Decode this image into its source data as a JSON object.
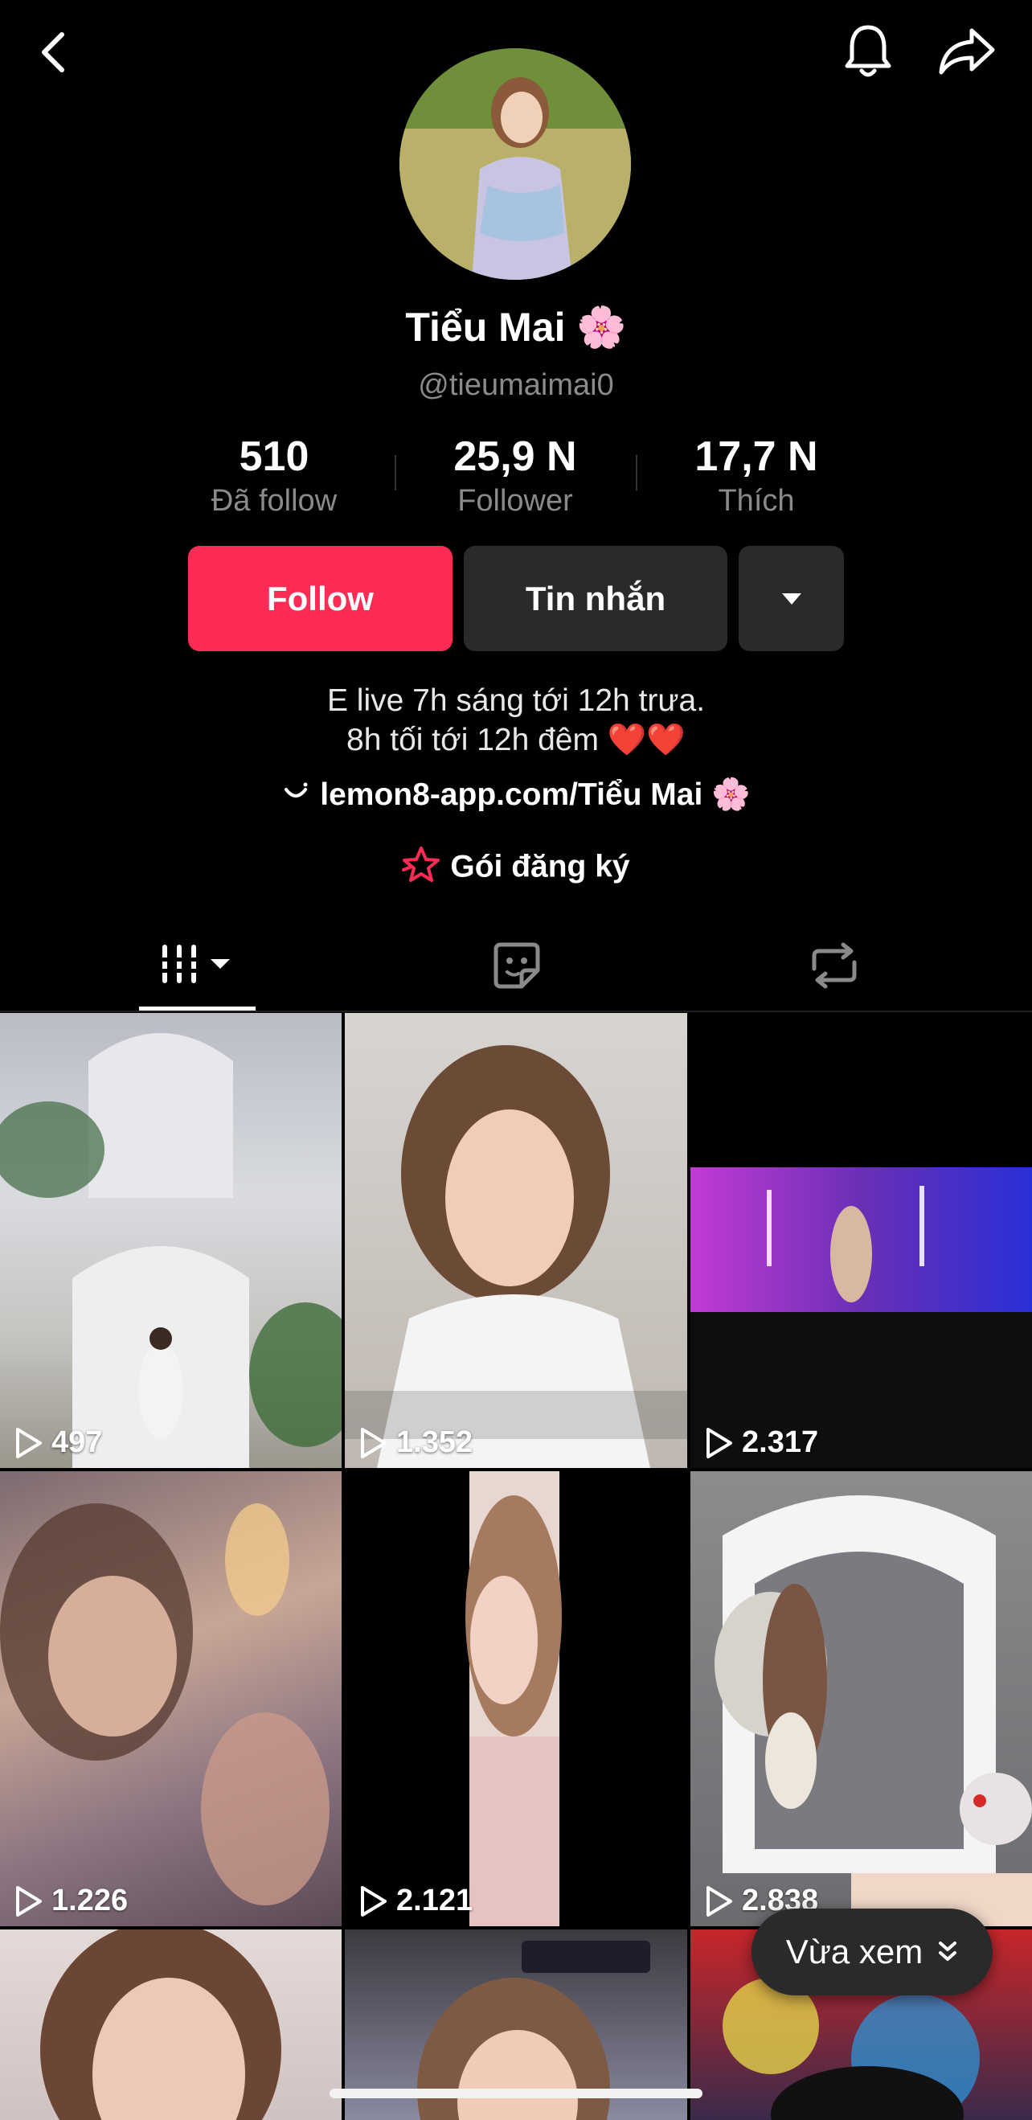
{
  "profile": {
    "display_name": "Tiểu Mai 🌸",
    "handle": "@tieumaimai0"
  },
  "stats": [
    {
      "value": "510",
      "label": "Đã follow"
    },
    {
      "value": "25,9 N",
      "label": "Follower"
    },
    {
      "value": "17,7 N",
      "label": "Thích"
    }
  ],
  "actions": {
    "follow_label": "Follow",
    "message_label": "Tin nhắn"
  },
  "bio": {
    "line1": "E live 7h sáng tới 12h trưa.",
    "line2": "8h tối tới 12h đêm ❤️❤️",
    "link": "lemon8-app.com/Tiểu Mai 🌸",
    "subscription": "Gói đăng ký"
  },
  "colors": {
    "accent": "#FE2C55",
    "background": "#000000",
    "button_dark": "#2A2A2A"
  },
  "tabs": [
    {
      "icon": "videos-grid-icon",
      "active": true
    },
    {
      "icon": "sticker-icon",
      "active": false
    },
    {
      "icon": "repost-icon",
      "active": false
    }
  ],
  "videos": [
    {
      "views": "497"
    },
    {
      "views": "1.352"
    },
    {
      "views": "2.317"
    },
    {
      "views": "1.226"
    },
    {
      "views": "2.121"
    },
    {
      "views": "2.838"
    },
    {},
    {},
    {}
  ],
  "recently_viewed": {
    "label": "Vừa xem"
  }
}
